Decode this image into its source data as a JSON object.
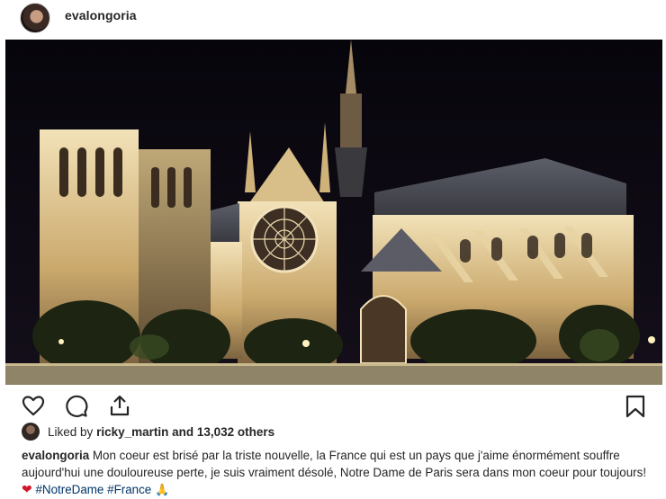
{
  "header": {
    "username": "evalongoria"
  },
  "photo": {
    "subject-icon": "cathedral-night-photo"
  },
  "actions": {
    "icons": [
      "heart-icon",
      "comment-icon",
      "share-icon",
      "bookmark-icon"
    ]
  },
  "likes": {
    "prefix": "Liked by",
    "user": "ricky_martin",
    "suffix": "and 13,032 others"
  },
  "caption": {
    "user": "evalongoria",
    "text": "Mon coeur est brisé par la triste nouvelle, la France qui est un pays que j'aime énormément souffre aujourd'hui une douloureuse perte, je suis vraiment désolé, Notre Dame de Paris sera dans mon coeur pour toujours!",
    "emoji_heart": "❤",
    "hashtag1": "#NotreDame",
    "hashtag2": "#France",
    "emoji_pray": "🙏"
  },
  "colors": {
    "text": "#262626",
    "hashtag": "#003569",
    "heart": "#d0182c"
  }
}
